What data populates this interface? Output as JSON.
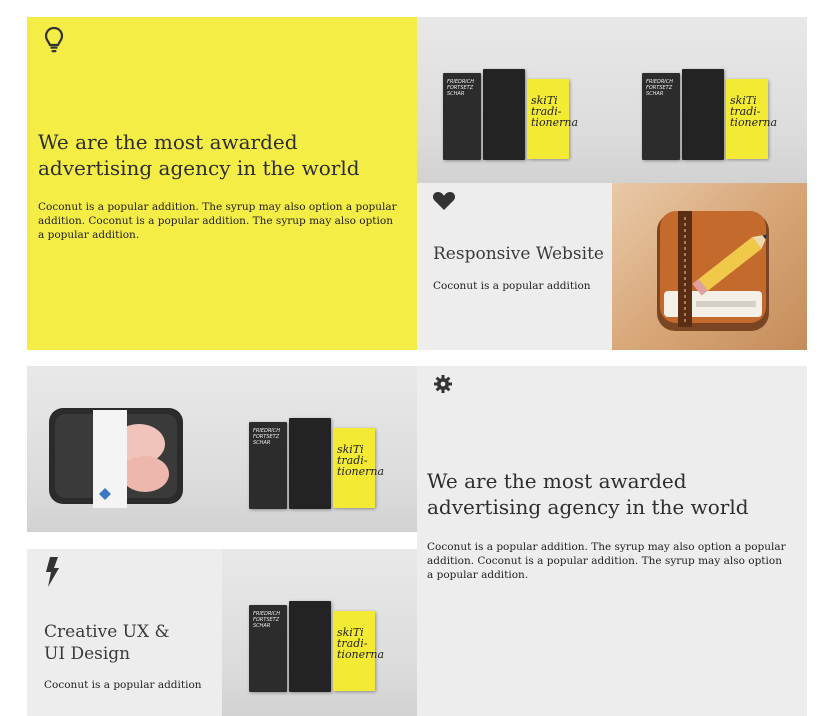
{
  "tile1": {
    "icon": "lightbulb-icon",
    "headline": "We are the most awarded advertising agency in the world",
    "body": "Coconut is a popular addition. The syrup may also option a popular addition. Coconut is a popular addition. The syrup may also option a popular addition."
  },
  "tile2": {
    "icon": "heart-icon",
    "title": "Responsive Website",
    "body": "Coconut is a popular addition"
  },
  "tile3": {
    "icon": "gear-icon",
    "headline": "We are the most awarded advertising agency in the world",
    "body": "Coconut is a popular addition. The syrup may also option a popular addition. Coconut is a popular addition. The syrup may also option a popular addition."
  },
  "tile4": {
    "icon": "lightning-bolt-icon",
    "title": "Creative UX &\nUI Design",
    "body": "Coconut is a popular addition"
  },
  "book_image": {
    "spine_text": "FRIEDRICH FORTSETZ SCHAR",
    "script_text": "skiTi tradi-tionerna"
  },
  "colors": {
    "accent_yellow": "#f4ed45",
    "panel_grey": "#ededed",
    "text_dark": "#2e2e2e"
  }
}
